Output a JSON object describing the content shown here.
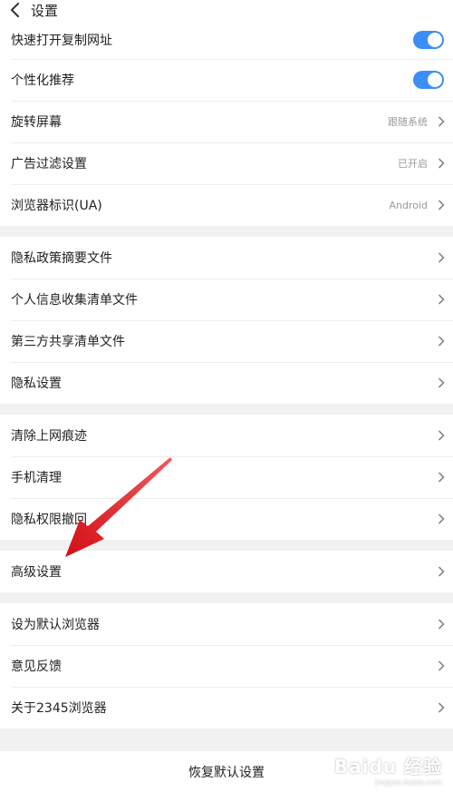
{
  "header": {
    "title": "设置"
  },
  "groups": [
    {
      "rows": [
        {
          "label": "快速打开复制网址",
          "kind": "toggle",
          "on": true
        },
        {
          "label": "个性化推荐",
          "kind": "toggle",
          "on": true
        },
        {
          "label": "旋转屏幕",
          "kind": "nav",
          "value": "跟随系统"
        },
        {
          "label": "广告过滤设置",
          "kind": "nav",
          "value": "已开启"
        },
        {
          "label": "浏览器标识(UA)",
          "kind": "nav",
          "value": "Android"
        }
      ]
    },
    {
      "rows": [
        {
          "label": "隐私政策摘要文件",
          "kind": "nav"
        },
        {
          "label": "个人信息收集清单文件",
          "kind": "nav"
        },
        {
          "label": "第三方共享清单文件",
          "kind": "nav"
        },
        {
          "label": "隐私设置",
          "kind": "nav"
        }
      ]
    },
    {
      "rows": [
        {
          "label": "清除上网痕迹",
          "kind": "nav"
        },
        {
          "label": "手机清理",
          "kind": "nav"
        },
        {
          "label": "隐私权限撤回",
          "kind": "nav"
        }
      ]
    },
    {
      "rows": [
        {
          "label": "高级设置",
          "kind": "nav"
        }
      ]
    },
    {
      "rows": [
        {
          "label": "设为默认浏览器",
          "kind": "nav"
        },
        {
          "label": "意见反馈",
          "kind": "nav"
        },
        {
          "label": "关于2345浏览器",
          "kind": "nav"
        }
      ]
    }
  ],
  "reset": {
    "label": "恢复默认设置"
  },
  "watermark": {
    "brand": "Baidu 经验",
    "site": "jingyan.baidu.com"
  },
  "colors": {
    "toggle_on": "#3b8ef5",
    "annotation_arrow": "#e0161c"
  }
}
